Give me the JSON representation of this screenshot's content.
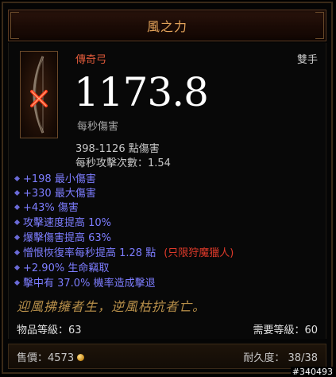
{
  "title": "風之力",
  "item_type": "傳奇弓",
  "hand_type": "雙手",
  "dps": "1173.8",
  "dps_label": "每秒傷害",
  "damage_range": "398-1126 點傷害",
  "attacks_per_second": "每秒攻擊次數：1.54",
  "affixes": [
    {
      "text": "+198 最小傷害"
    },
    {
      "text": "+330 最大傷害"
    },
    {
      "text": "+43% 傷害"
    },
    {
      "text": "攻擊速度提高 10%"
    },
    {
      "text": "爆擊傷害提高 63%"
    },
    {
      "text": "憎恨恢復率每秒提高 1.28 點",
      "requirement": "(只限狩魔獵人)"
    },
    {
      "text": "+2.90% 生命竊取"
    },
    {
      "text": "擊中有 37.0% 機率造成擊退"
    }
  ],
  "flavor_text": "迎風拂擁者生，逆風枯抗者亡。",
  "item_level": "物品等級：63",
  "required_level": "需要等級：60",
  "sell_price_label": "售價：4573",
  "durability": "耐久度： 38/38",
  "watermark": "#340493",
  "colors": {
    "title": "#e3a35a",
    "legendary": "#e05a3a",
    "magic_affix": "#7d7dff",
    "requirement": "#e03a2a",
    "flavor": "#b8904a"
  },
  "icons": [
    "legendary-bow-icon",
    "gold-coin-icon"
  ]
}
